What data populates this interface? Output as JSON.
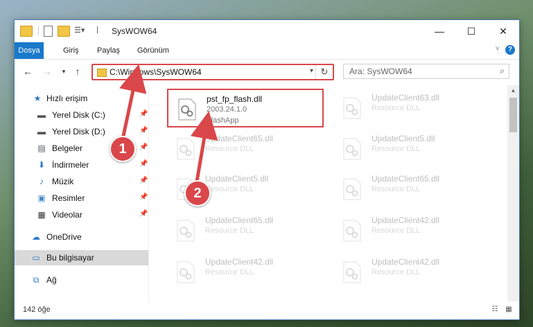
{
  "window": {
    "title": "SysWOW64"
  },
  "ribbon": {
    "tabs": [
      "Dosya",
      "Giriş",
      "Paylaş",
      "Görünüm"
    ]
  },
  "address": {
    "path": "C:\\Windows\\SysWOW64",
    "search_placeholder": "Ara: SysWOW64"
  },
  "sidebar": {
    "items": [
      {
        "label": "Hızlı erişim",
        "icon": "star-icon"
      },
      {
        "label": "Yerel Disk (C:)",
        "icon": "drive-icon"
      },
      {
        "label": "Yerel Disk (D:)",
        "icon": "drive-icon"
      },
      {
        "label": "Belgeler",
        "icon": "documents-icon"
      },
      {
        "label": "İndirmeler",
        "icon": "downloads-icon"
      },
      {
        "label": "Müzik",
        "icon": "music-icon"
      },
      {
        "label": "Resimler",
        "icon": "pictures-icon"
      },
      {
        "label": "Videolar",
        "icon": "videos-icon"
      },
      {
        "label": "OneDrive",
        "icon": "cloud-icon"
      },
      {
        "label": "Bu bilgisayar",
        "icon": "computer-icon"
      },
      {
        "label": "Ağ",
        "icon": "network-icon"
      }
    ]
  },
  "files": [
    {
      "name": "pst_fp_flash.dll",
      "line2": "2003.24.1.0",
      "line3": "FlashApp"
    },
    {
      "name": "UpdateClient63.dll",
      "line2": "Resource DLL"
    },
    {
      "name": "UpdateClient65.dll",
      "line2": "Resource DLL"
    },
    {
      "name": "UpdateClient5.dll",
      "line2": "Resource DLL"
    },
    {
      "name": "UpdateClient5.dll",
      "line2": "Resource DLL"
    },
    {
      "name": "UpdateClient65.dll",
      "line2": "Resource DLL"
    },
    {
      "name": "UpdateClient65.dll",
      "line2": "Resource DLL"
    },
    {
      "name": "UpdateClient42.dll",
      "line2": "Resource DLL"
    },
    {
      "name": "UpdateClient42.dll",
      "line2": "Resource DLL"
    },
    {
      "name": "UpdateClient42.dll",
      "line2": "Resource DLL"
    }
  ],
  "status": {
    "count": "142 öğe"
  },
  "annotations": {
    "callout1": "1",
    "callout2": "2"
  },
  "colors": {
    "accent": "#1979ca",
    "highlight": "#d9474a"
  }
}
